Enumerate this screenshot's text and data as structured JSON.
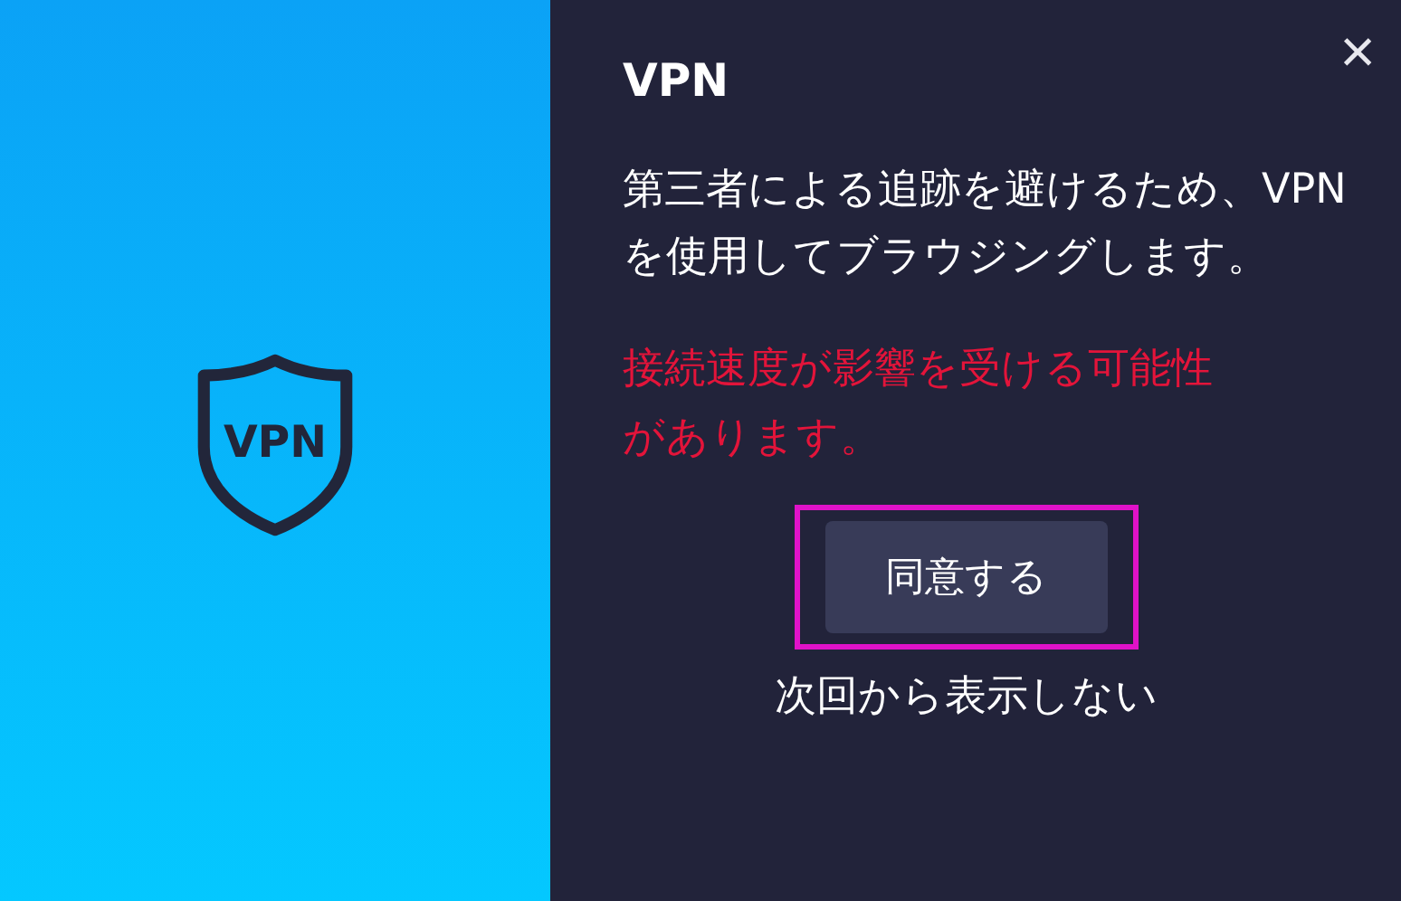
{
  "close": {
    "glyph": "×"
  },
  "badge": {
    "label": "VPN"
  },
  "title": "VPN",
  "message": "第三者による追跡を避けるため、VPNを使用してブラウジングします。",
  "warning": "接続速度が影響を受ける可能性があります。",
  "agree_button": {
    "label": "同意する",
    "focused": true
  },
  "dont_show_link": "次回から表示しない"
}
